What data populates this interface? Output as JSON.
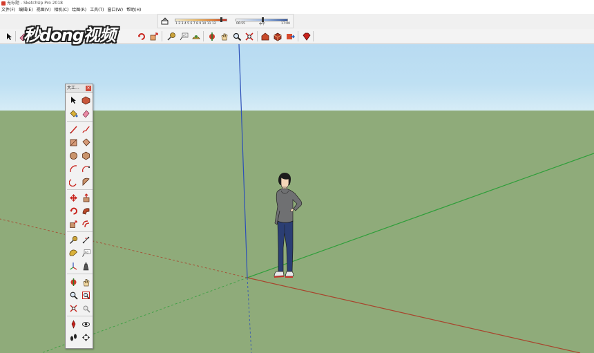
{
  "window": {
    "title": "无标题 - SketchUp Pro 2018"
  },
  "menu": {
    "items": [
      "文件(F)",
      "编辑(E)",
      "视图(V)",
      "相机(C)",
      "绘图(R)",
      "工具(T)",
      "窗口(W)",
      "帮助(H)"
    ]
  },
  "shadows": {
    "month_ticks": "1 2 3 4 5 6 7 8 9 10 11 12",
    "time_start": "06:55",
    "time_mid": "中午",
    "time_end": "17:00"
  },
  "toolbar": {
    "icons": [
      "select-icon",
      "eraser-icon",
      "paint-icon",
      "move-icon",
      "rotate-icon",
      "scale-icon",
      "push-pull-icon",
      "tape-measure-icon",
      "text-icon",
      "protractor-icon",
      "orbit-icon",
      "pan-icon",
      "zoom-icon",
      "zoom-extents-icon",
      "warehouse-icon",
      "extension-icon",
      "share-icon",
      "ruby-icon"
    ]
  },
  "watermark": {
    "text": "秒dong视频"
  },
  "palette": {
    "title": "大工...",
    "tools": [
      [
        "select-tool-icon",
        "make-component-icon"
      ],
      [
        "paint-bucket-icon",
        "eraser-tool-icon"
      ],
      [
        "line-tool-icon",
        "freehand-tool-icon"
      ],
      [
        "rectangle-tool-icon",
        "rotated-rectangle-icon"
      ],
      [
        "circle-tool-icon",
        "polygon-tool-icon"
      ],
      [
        "arc-tool-icon",
        "two-point-arc-icon"
      ],
      [
        "three-point-arc-icon",
        "pie-tool-icon"
      ],
      [
        "move-tool-icon",
        "push-pull-tool-icon"
      ],
      [
        "rotate-tool-icon",
        "follow-me-icon"
      ],
      [
        "scale-tool-icon",
        "offset-tool-icon"
      ],
      [
        "tape-measure-tool-icon",
        "dimension-tool-icon"
      ],
      [
        "protractor-tool-icon",
        "text-tool-icon"
      ],
      [
        "axes-tool-icon",
        "3d-text-icon"
      ],
      [
        "orbit-tool-icon",
        "pan-tool-icon"
      ],
      [
        "zoom-tool-icon",
        "zoom-window-icon"
      ],
      [
        "zoom-extents-tool-icon",
        "previous-view-icon"
      ],
      [
        "position-camera-icon",
        "look-around-icon"
      ],
      [
        "walk-tool-icon",
        "section-plane-icon"
      ]
    ]
  },
  "colors": {
    "sky": "#bfe0f3",
    "ground": "#8fab7a",
    "axis_red": "#a8442c",
    "axis_green": "#2f9e3a",
    "axis_blue": "#2c4fb8"
  }
}
